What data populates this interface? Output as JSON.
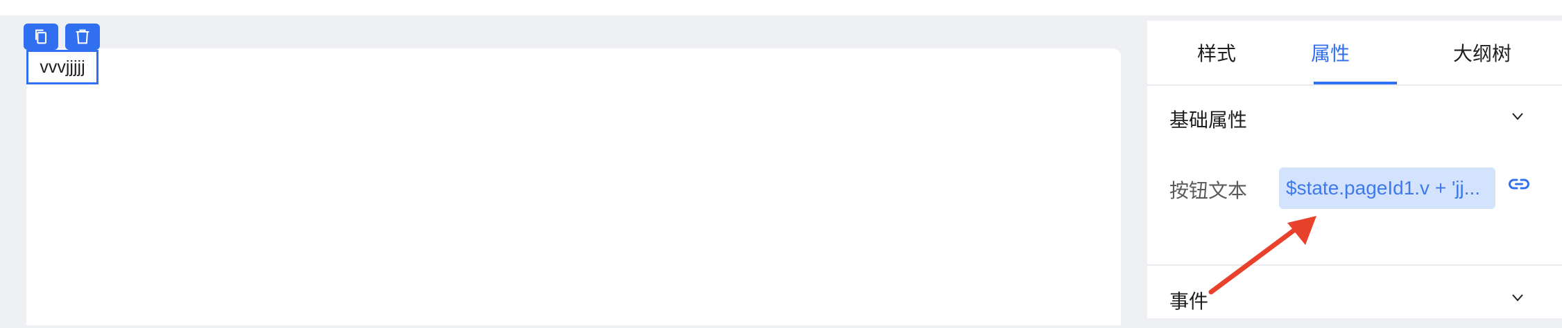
{
  "canvas": {
    "toolbar": {
      "icons": [
        "copy-icon",
        "trash-icon"
      ]
    },
    "button_text": "vvvjjjjj"
  },
  "panel": {
    "tabs": [
      {
        "label": "样式",
        "active": false
      },
      {
        "label": "属性",
        "active": true
      },
      {
        "label": "大纲树",
        "active": false
      }
    ],
    "sections": [
      {
        "title": "基础属性",
        "expanded": true
      },
      {
        "title": "事件",
        "expanded": false
      }
    ],
    "property": {
      "label": "按钮文本",
      "value": "$state.pageId1.v + 'jj..."
    }
  },
  "colors": {
    "accent": "#2f6ff0",
    "value_bg": "#d3e3fd",
    "arrow": "#e8412c"
  }
}
